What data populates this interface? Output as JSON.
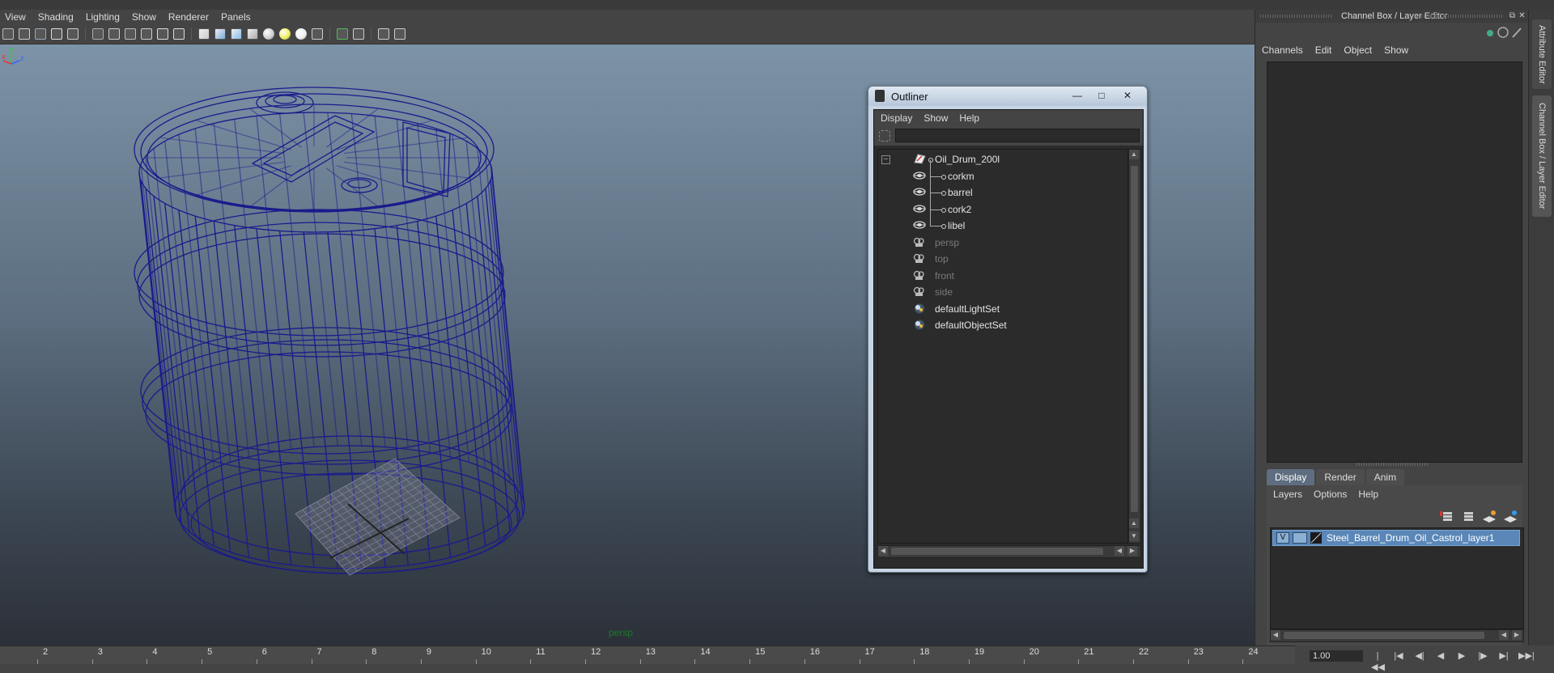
{
  "viewport": {
    "menu": [
      "View",
      "Shading",
      "Lighting",
      "Show",
      "Renderer",
      "Panels"
    ],
    "camera_label": "persp",
    "axis": {
      "x": "x",
      "y": "y",
      "z": "z"
    },
    "toolbar_icons": [
      "select-camera-icon",
      "camera-attributes-icon",
      "bookmark-icon",
      "image-plane-icon",
      "grid-icon",
      "film-gate-icon",
      "resolution-gate-icon",
      "gate-mask-icon",
      "field-chart-icon",
      "safe-action-icon",
      "safe-title-icon",
      "wireframe-icon",
      "smooth-shade-icon",
      "wireframe-on-shaded-icon",
      "textured-icon",
      "shadows-icon",
      "use-all-lights-icon",
      "default-light-icon",
      "xray-icon",
      "isolate-select-icon",
      "xray-joints-icon",
      "xray-active-icon",
      "hud-icon"
    ]
  },
  "timeline": {
    "frames": [
      "2",
      "3",
      "4",
      "5",
      "6",
      "7",
      "8",
      "9",
      "10",
      "11",
      "12",
      "13",
      "14",
      "15",
      "16",
      "17",
      "18",
      "19",
      "20",
      "21",
      "22",
      "23",
      "24"
    ],
    "current_time": "1.00"
  },
  "outliner": {
    "title": "Outliner",
    "menu": [
      "Display",
      "Show",
      "Help"
    ],
    "tree": [
      {
        "label": "Oil_Drum_200l",
        "icon": "group-icon",
        "level": 0,
        "dim": false,
        "expanded": true
      },
      {
        "label": "corkm",
        "icon": "mesh-icon",
        "level": 1,
        "dim": false
      },
      {
        "label": "barrel",
        "icon": "mesh-icon",
        "level": 1,
        "dim": false
      },
      {
        "label": "cork2",
        "icon": "mesh-icon",
        "level": 1,
        "dim": false
      },
      {
        "label": "libel",
        "icon": "mesh-icon",
        "level": 1,
        "dim": false,
        "last": true
      },
      {
        "label": "persp",
        "icon": "camera-icon",
        "level": 0,
        "dim": true
      },
      {
        "label": "top",
        "icon": "camera-icon",
        "level": 0,
        "dim": true
      },
      {
        "label": "front",
        "icon": "camera-icon",
        "level": 0,
        "dim": true
      },
      {
        "label": "side",
        "icon": "camera-icon",
        "level": 0,
        "dim": true
      },
      {
        "label": "defaultLightSet",
        "icon": "set-icon",
        "level": 0,
        "dim": false
      },
      {
        "label": "defaultObjectSet",
        "icon": "set-icon",
        "level": 0,
        "dim": false
      }
    ]
  },
  "right_panel": {
    "title": "Channel Box / Layer Editor",
    "menu": [
      "Channels",
      "Edit",
      "Object",
      "Show"
    ],
    "tabs": [
      "Display",
      "Render",
      "Anim"
    ],
    "active_tab": "Display",
    "layer_menu": [
      "Layers",
      "Options",
      "Help"
    ],
    "layers": [
      {
        "visible": "V",
        "name": "Steel_Barrel_Drum_Oil_Castrol_layer1"
      }
    ],
    "side_tabs": [
      "Attribute Editor",
      "Channel Box / Layer Editor"
    ]
  },
  "colors": {
    "wireframe": "#1a1a8c",
    "layer_selected": "#5a87b8",
    "viewport_top": "#7d93a7",
    "viewport_bottom": "#2c3038",
    "camera_label": "#1a7a2a"
  }
}
